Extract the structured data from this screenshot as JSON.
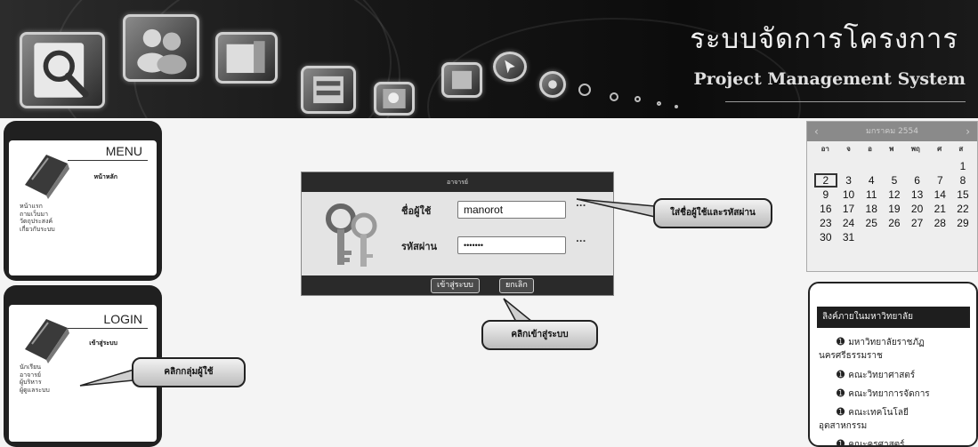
{
  "header": {
    "title_th": "ระบบจัดการโครงการ",
    "title_en": "Project Management System"
  },
  "menu_panel": {
    "heading": "MENU",
    "subheading": "หน้าหลัก",
    "items": [
      "หน้าแรก",
      "ถามเว็บมา",
      "วัตถุประสงค์",
      "เกี่ยวกับระบบ"
    ]
  },
  "login_panel": {
    "heading": "LOGIN",
    "subheading": "เข้าสู่ระบบ",
    "items": [
      "นักเรียน",
      "อาจารย์",
      "ผู้บริหาร",
      "ผู้ดูแลระบบ"
    ]
  },
  "login_form": {
    "header": "อาจารย์",
    "username_label": "ชื่อผู้ใช้",
    "username_value": "manorot",
    "password_label": "รหัสผ่าน",
    "password_value": "•••••••",
    "hint_dots_1": "...",
    "hint_dots_2": "...",
    "submit_label": "เข้าสู่ระบบ",
    "cancel_label": "ยกเลิก"
  },
  "callouts": {
    "enter_credentials": "ใส่ชื่อผู้ใช้และรหัสผ่าน",
    "click_login": "คลิกเข้าสู่ระบบ",
    "click_user_group": "คลิกกลุ่มผู้ใช้"
  },
  "calendar": {
    "month_label": "มกราคม 2554",
    "weekdays": [
      "อา",
      "จ",
      "อ",
      "พ",
      "พฤ",
      "ศ",
      "ส"
    ],
    "days": [
      "",
      "",
      "",
      "",
      "",
      "",
      "1",
      "2",
      "3",
      "4",
      "5",
      "6",
      "7",
      "8",
      "9",
      "10",
      "11",
      "12",
      "13",
      "14",
      "15",
      "16",
      "17",
      "18",
      "19",
      "20",
      "21",
      "22",
      "23",
      "24",
      "25",
      "26",
      "27",
      "28",
      "29",
      "30",
      "31",
      "",
      "",
      "",
      "",
      ""
    ],
    "today": "2"
  },
  "links": {
    "heading": "ลิงค์ภายในมหาวิทยาลัย",
    "items": [
      {
        "line1": "มหาวิทยาลัยราชภัฏ",
        "line2": "นครศรีธรรมราช"
      },
      {
        "line1": "คณะวิทยาศาสตร์",
        "line2": ""
      },
      {
        "line1": "คณะวิทยาการจัดการ",
        "line2": ""
      },
      {
        "line1": "คณะเทคโนโลยี",
        "line2": "อุตสาหกรรม"
      },
      {
        "line1": "คณะครุศาสตร์",
        "line2": ""
      }
    ]
  },
  "icons": [
    "search-icon",
    "users-icon",
    "document-icon",
    "folder-icon",
    "box-icon",
    "image-icon",
    "cursor-icon",
    "gear-icon",
    "book-icon",
    "keys-icon",
    "bullet-icon"
  ]
}
